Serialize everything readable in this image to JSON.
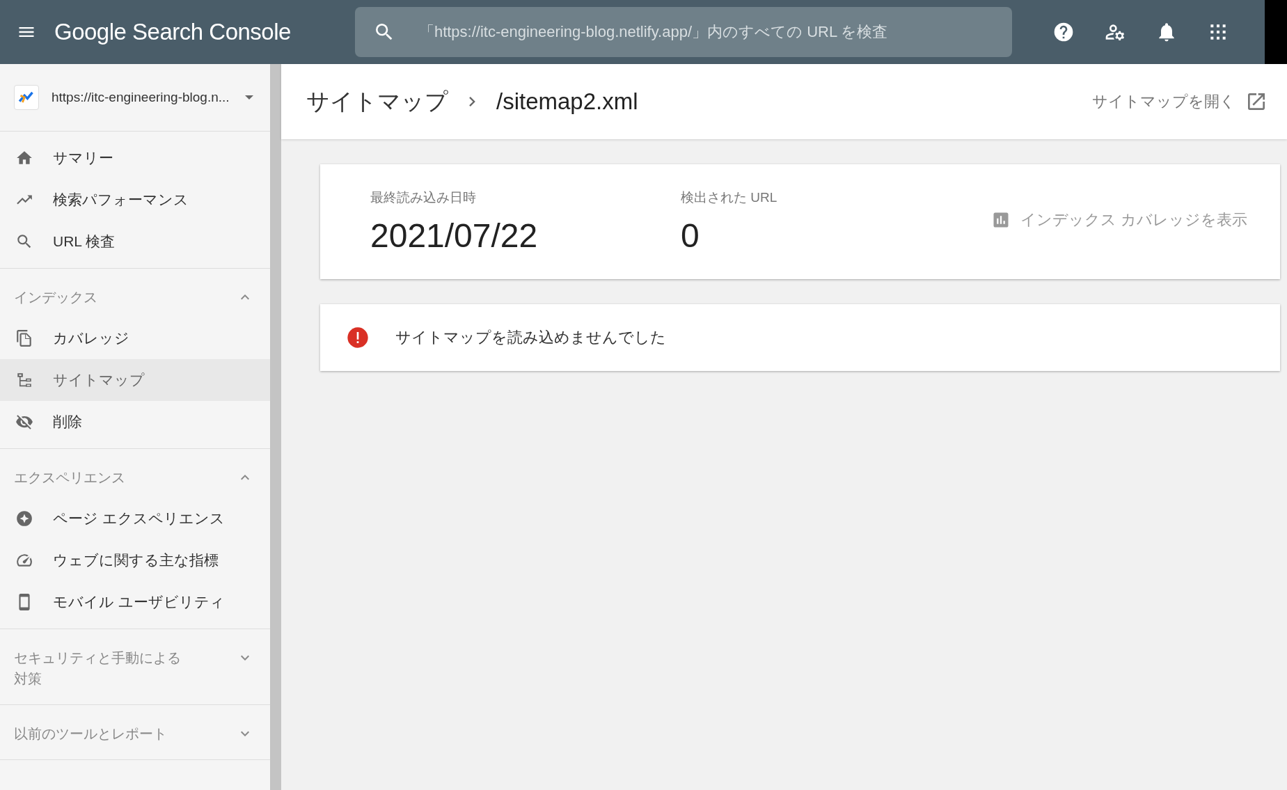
{
  "header": {
    "title": "Google Search Console",
    "search": {
      "placeholder": "「https://itc-engineering-blog.netlify.app/」内のすべての URL を検査"
    }
  },
  "sidebar": {
    "property": "https://itc-engineering-blog.n...",
    "top_items": [
      {
        "label": "サマリー",
        "selected": false
      },
      {
        "label": "検索パフォーマンス",
        "selected": false
      },
      {
        "label": "URL 検査",
        "selected": false
      }
    ],
    "sections": [
      {
        "title": "インデックス",
        "expanded": true,
        "items": [
          {
            "label": "カバレッジ",
            "selected": false
          },
          {
            "label": "サイトマップ",
            "selected": true
          },
          {
            "label": "削除",
            "selected": false
          }
        ]
      },
      {
        "title": "エクスペリエンス",
        "expanded": true,
        "items": [
          {
            "label": "ページ エクスペリエンス",
            "selected": false
          },
          {
            "label": "ウェブに関する主な指標",
            "selected": false
          },
          {
            "label": "モバイル ユーザビリティ",
            "selected": false
          }
        ]
      },
      {
        "title": "セキュリティと手動による対策",
        "expanded": false
      },
      {
        "title": "以前のツールとレポート",
        "expanded": false
      }
    ]
  },
  "page": {
    "breadcrumb": "サイトマップ",
    "title": "/sitemap2.xml",
    "open_link": "サイトマップを開く"
  },
  "summary": {
    "stats": [
      {
        "label": "最終読み込み日時",
        "value": "2021/07/22"
      },
      {
        "label": "検出された URL",
        "value": "0"
      }
    ],
    "coverage_link": "インデックス カバレッジを表示"
  },
  "error": {
    "message": "サイトマップを読み込めませんでした"
  }
}
